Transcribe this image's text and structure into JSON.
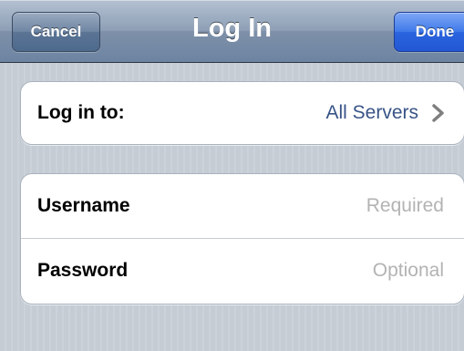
{
  "navbar": {
    "title": "Log In",
    "cancel_label": "Cancel",
    "done_label": "Done"
  },
  "server_row": {
    "label": "Log in to:",
    "value": "All Servers",
    "accessory_icon": "chevron-right-icon"
  },
  "credentials": {
    "username": {
      "label": "Username",
      "value": "",
      "placeholder": "Required"
    },
    "password": {
      "label": "Password",
      "value": "",
      "placeholder": "Optional"
    }
  },
  "colors": {
    "background": "#c5ccd4",
    "navbar": "#7e90a9",
    "done_button": "#2a64df",
    "value_text": "#385487",
    "placeholder_text": "#b3b3b3"
  }
}
